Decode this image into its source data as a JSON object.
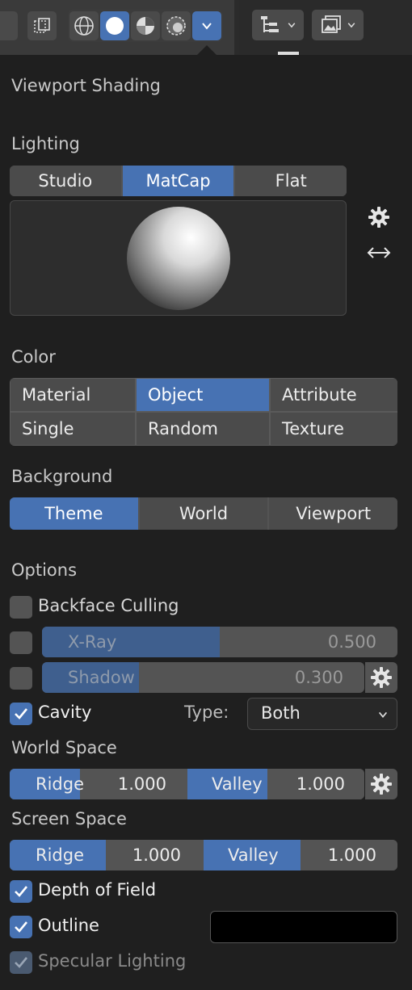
{
  "header": {
    "icons": [
      "toggle-icon",
      "wireframe-icon",
      "solid-icon",
      "material-preview-icon",
      "rendered-icon",
      "chevron-down-icon",
      "outliner-icon",
      "image-editor-icon"
    ]
  },
  "panel": {
    "title": "Viewport Shading",
    "lighting": {
      "label": "Lighting",
      "options": [
        "Studio",
        "MatCap",
        "Flat"
      ],
      "selected": "MatCap"
    },
    "color": {
      "label": "Color",
      "options": [
        "Material",
        "Object",
        "Attribute",
        "Single",
        "Random",
        "Texture"
      ],
      "selected": "Object"
    },
    "background": {
      "label": "Background",
      "options": [
        "Theme",
        "World",
        "Viewport"
      ],
      "selected": "Theme"
    },
    "options": {
      "label": "Options",
      "backface": {
        "label": "Backface Culling",
        "checked": false
      },
      "xray": {
        "label": "X-Ray",
        "value": "0.500",
        "fraction": 0.5,
        "checked": false
      },
      "shadow": {
        "label": "Shadow",
        "value": "0.300",
        "fraction": 0.3,
        "checked": false
      },
      "cavity": {
        "label": "Cavity",
        "checked": true,
        "type_label": "Type:",
        "type_value": "Both"
      },
      "world_space": {
        "label": "World Space",
        "ridge_label": "Ridge",
        "ridge_value": "1.000",
        "ridge_fraction": 0.4,
        "valley_label": "Valley",
        "valley_value": "1.000",
        "valley_fraction": 0.45
      },
      "screen_space": {
        "label": "Screen Space",
        "ridge_label": "Ridge",
        "ridge_value": "1.000",
        "ridge_fraction": 0.5,
        "valley_label": "Valley",
        "valley_value": "1.000",
        "valley_fraction": 0.5
      },
      "dof": {
        "label": "Depth of Field",
        "checked": true
      },
      "outline": {
        "label": "Outline",
        "checked": true,
        "color": "#000000"
      },
      "specular": {
        "label": "Specular Lighting",
        "checked": true
      }
    }
  },
  "colors": {
    "accent": "#4772b3",
    "panel": "#1f1f1f",
    "button": "#4b4b4b"
  }
}
